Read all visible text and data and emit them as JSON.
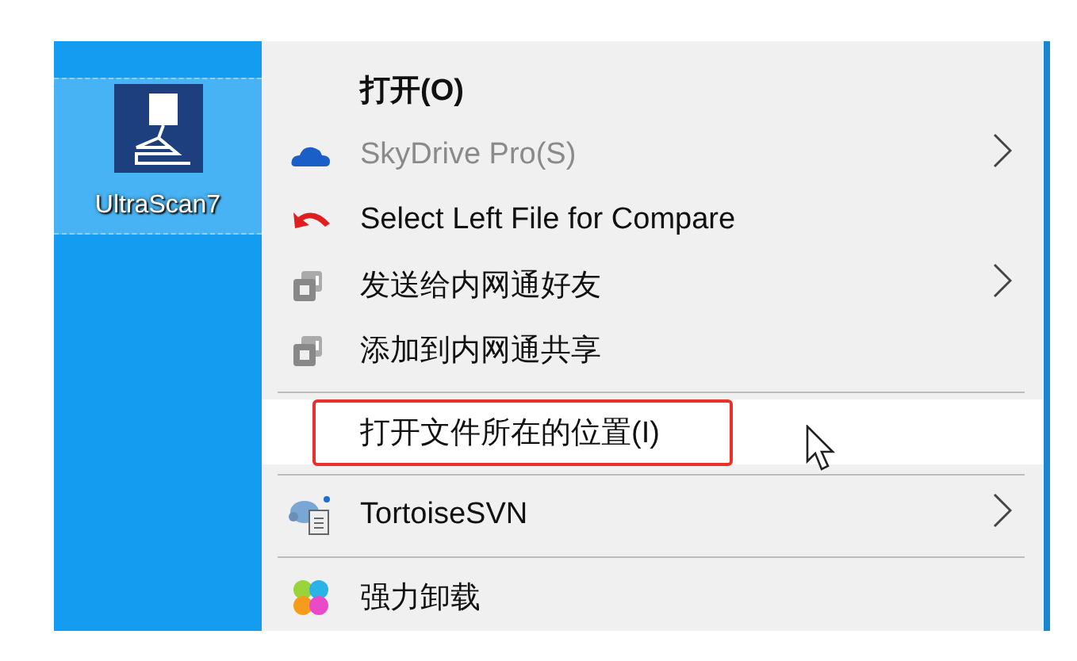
{
  "desktop_icon": {
    "label": "UltraScan7",
    "selected": true
  },
  "context_menu": {
    "items": [
      {
        "kind": "item",
        "label": "打开(O)",
        "default": true,
        "disabled": false,
        "submenu": false,
        "selected": false,
        "marked": false
      },
      {
        "kind": "item",
        "label": "SkyDrive Pro(S)",
        "default": false,
        "disabled": true,
        "submenu": true,
        "selected": false,
        "marked": false
      },
      {
        "kind": "item",
        "label": "Select Left File for Compare",
        "default": false,
        "disabled": false,
        "submenu": false,
        "selected": false,
        "marked": false
      },
      {
        "kind": "item",
        "label": "发送给内网通好友",
        "default": false,
        "disabled": false,
        "submenu": true,
        "selected": false,
        "marked": false
      },
      {
        "kind": "item",
        "label": "添加到内网通共享",
        "default": false,
        "disabled": false,
        "submenu": false,
        "selected": false,
        "marked": false
      },
      {
        "kind": "separator"
      },
      {
        "kind": "item",
        "label": "打开文件所在的位置(I)",
        "default": false,
        "disabled": false,
        "submenu": false,
        "selected": true,
        "marked": true
      },
      {
        "kind": "separator"
      },
      {
        "kind": "item",
        "label": "TortoiseSVN",
        "default": false,
        "disabled": false,
        "submenu": true,
        "selected": false,
        "marked": false
      },
      {
        "kind": "separator"
      },
      {
        "kind": "item",
        "label": "强力卸载",
        "default": false,
        "disabled": false,
        "submenu": false,
        "selected": false,
        "marked": false
      }
    ]
  }
}
